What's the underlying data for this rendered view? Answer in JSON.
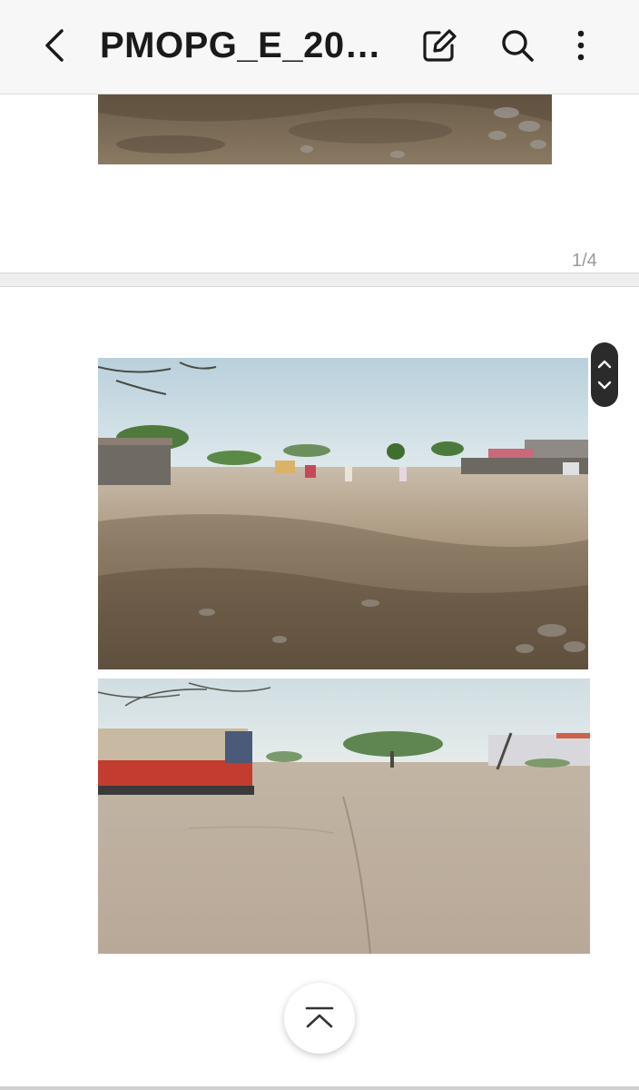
{
  "header": {
    "title": "PMOPG_E_20…",
    "icons": [
      "back-arrow-icon",
      "edit-icon",
      "search-icon",
      "more-vertical-icon"
    ]
  },
  "viewer": {
    "page_indicator": "1/4"
  },
  "colors": {
    "appbar_bg": "#f7f7f7",
    "text": "#1a1a1a",
    "page_indicator": "#9a9a9a",
    "scroll_thumb": "#2b2b2b"
  }
}
